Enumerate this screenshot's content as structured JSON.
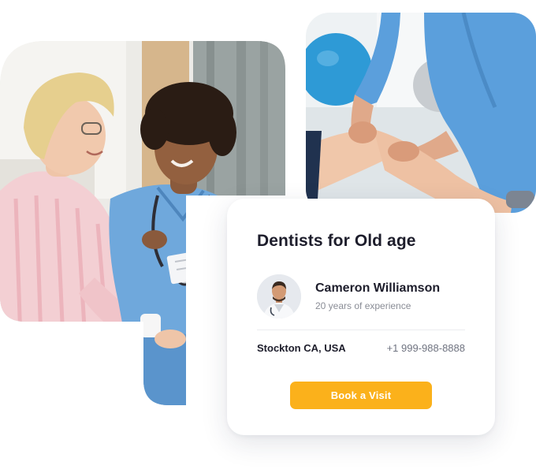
{
  "card": {
    "title": "Dentists for Old age",
    "doctor": {
      "name": "Cameron Williamson",
      "experience": "20 years of experience"
    },
    "location": "Stockton CA, USA",
    "phone": "+1 999-988-8888",
    "book_label": "Book a Visit"
  },
  "images": {
    "left": "caregiver-with-elderly-patient-photo",
    "right": "physiotherapy-knee-session-photo",
    "avatar": "doctor-avatar-photo"
  },
  "colors": {
    "accent": "#fbb11b",
    "heading": "#1d1d2b",
    "muted": "#8a8d96",
    "scrubs": "#6fa8dc"
  }
}
